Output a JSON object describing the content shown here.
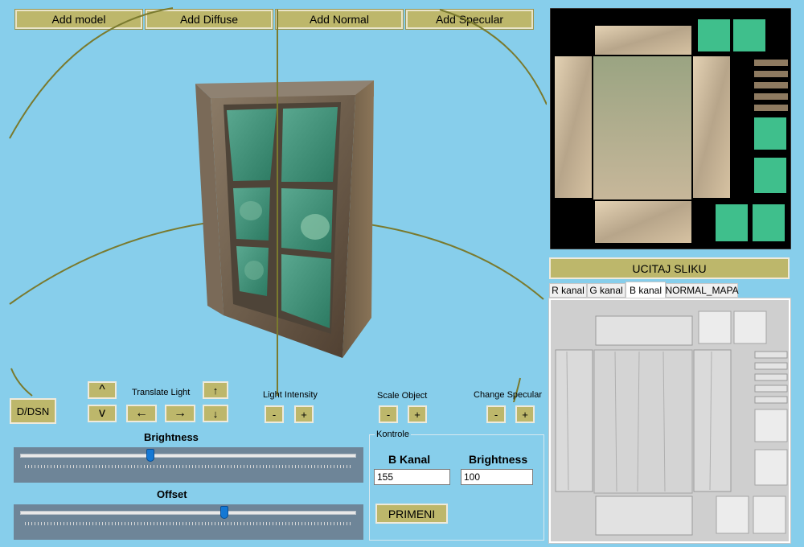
{
  "toolbar": {
    "add_model": "Add model",
    "add_diffuse": "Add Diffuse",
    "add_normal": "Add Normal",
    "add_specular": "Add Specular"
  },
  "viewport": {
    "orbit_color": "#7a7a2e",
    "light_axis_color": "#7a7a2e",
    "model": "window-frame"
  },
  "controls": {
    "ddsn": "D/DSN",
    "translate_light": "Translate Light",
    "arrow_up_small": "^",
    "arrow_down_small": "v",
    "arrow_left": "←",
    "arrow_right": "→",
    "arrow_up": "↑",
    "arrow_down": "↓",
    "light_intensity": "Light Intensity",
    "scale_object": "Scale Object",
    "change_specular": "Change Specular",
    "minus": "-",
    "plus": "+"
  },
  "sliders": {
    "brightness_label": "Brightness",
    "brightness_value": 0.39,
    "offset_label": "Offset",
    "offset_value": 0.61
  },
  "kontrole": {
    "group_title": "Kontrole",
    "b_kanal_label": "B Kanal",
    "b_kanal_value": "155",
    "brightness_label": "Brightness",
    "brightness_value": "100",
    "apply": "PRIMENI"
  },
  "right_panel": {
    "load_image": "UCITAJ SLIKU",
    "tabs": [
      "R kanal",
      "G kanal",
      "B kanal",
      "NORMAL_MAPA"
    ],
    "active_tab": "B kanal"
  },
  "colors": {
    "background": "#87ceeb",
    "button": "#bdb76b",
    "slider_thumb": "#1478d4"
  }
}
